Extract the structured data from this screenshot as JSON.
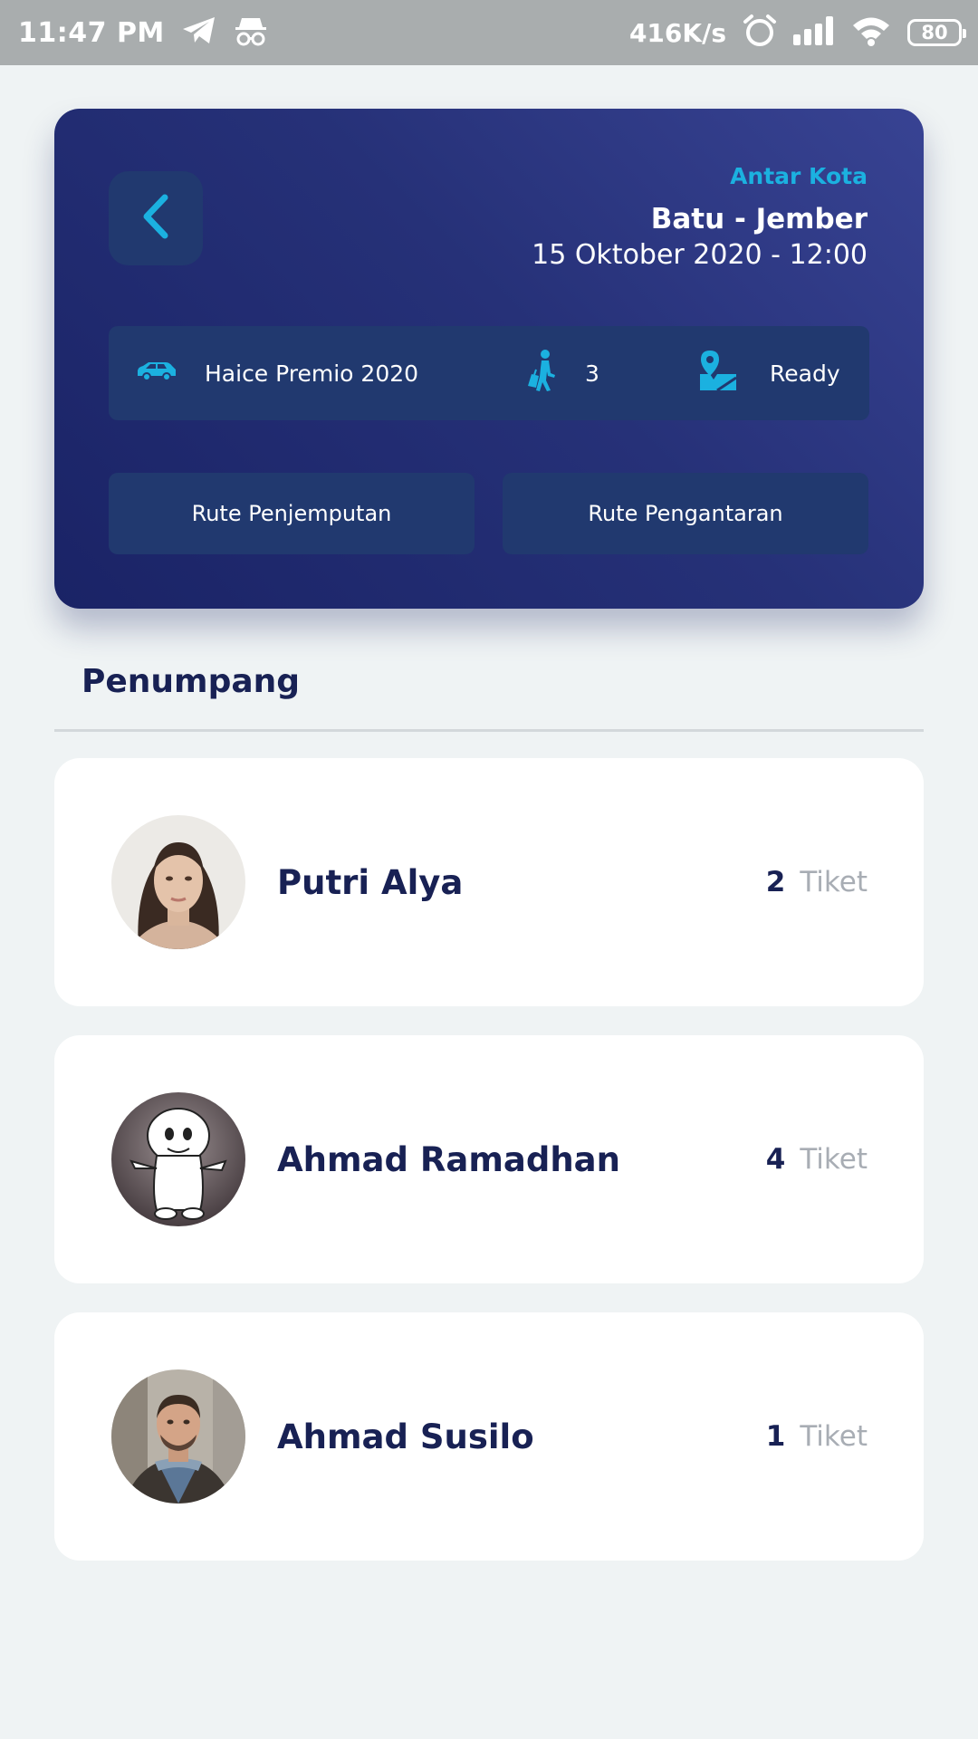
{
  "status_bar": {
    "time": "11:47 PM",
    "network_speed": "416K/s",
    "battery": "80",
    "icons": [
      "telegram-icon",
      "incognito-icon",
      "alarm-icon",
      "signal-icon",
      "wifi-icon",
      "battery-icon"
    ]
  },
  "trip": {
    "type": "Antar Kota",
    "route": "Batu - Jember",
    "datetime": "15 Oktober 2020 - 12:00",
    "vehicle": "Haice Premio 2020",
    "passenger_count": "3",
    "status": "Ready",
    "pickup_route_label": "Rute Penjemputan",
    "dropoff_route_label": "Rute Pengantaran"
  },
  "section": {
    "title": "Penumpang"
  },
  "passengers": [
    {
      "name": "Putri Alya",
      "tickets": "2",
      "unit": "Tiket"
    },
    {
      "name": "Ahmad Ramadhan",
      "tickets": "4",
      "unit": "Tiket"
    },
    {
      "name": "Ahmad Susilo",
      "tickets": "1",
      "unit": "Tiket"
    }
  ],
  "colors": {
    "accent": "#1bb1e0",
    "navy": "#182154",
    "card_dark": "#263178",
    "muted": "#a8adb4",
    "background": "#eff3f4"
  }
}
